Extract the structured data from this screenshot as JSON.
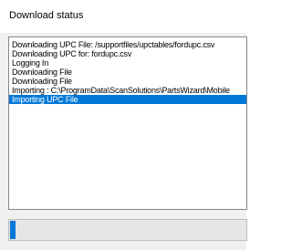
{
  "window": {
    "title": "Download status"
  },
  "log": {
    "lines": [
      "Downloading UPC File: /supportfiles/upctables/fordupc.csv",
      "Downloading UPC for: fordupc.csv",
      "Logging In",
      "Downloading File",
      "Downloading File",
      "Importing : C:\\ProgramData\\ScanSolutions\\PartsWizard\\Mobile",
      "Importing UPC File"
    ],
    "selected_index": 6,
    "selected_color": "#0078d7"
  },
  "progress": {
    "fraction": 0.025,
    "color": "#0078d7"
  }
}
